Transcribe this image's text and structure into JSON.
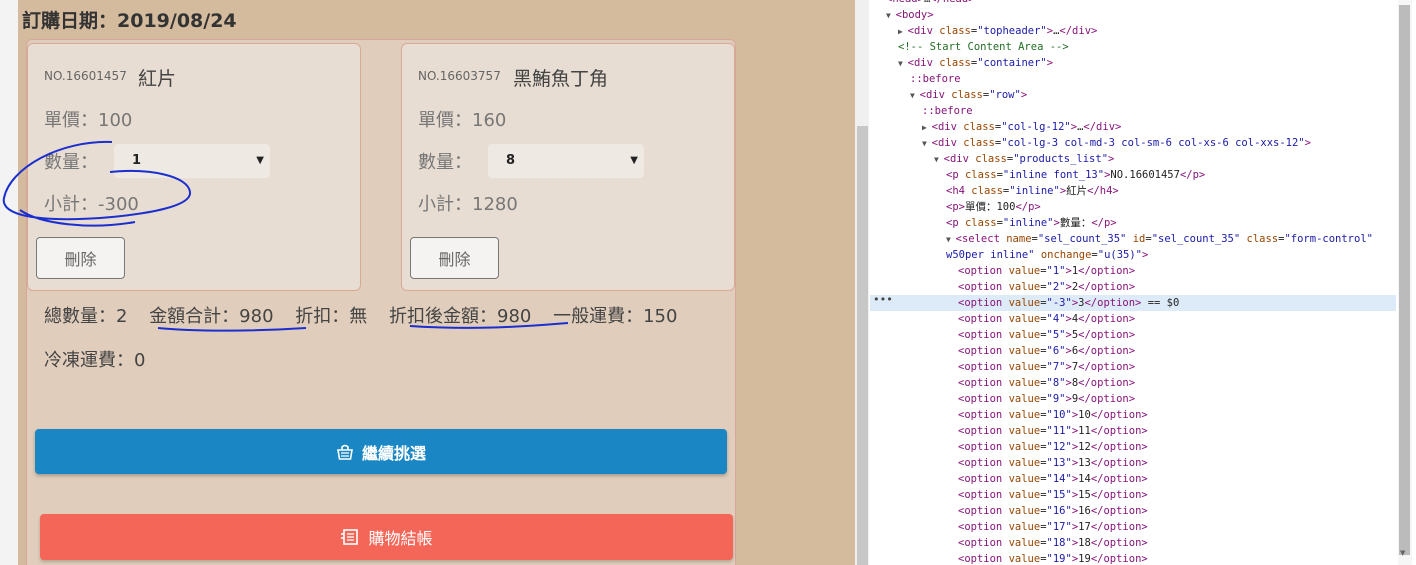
{
  "order": {
    "date_label": "訂購日期：2019/08/24"
  },
  "products": [
    {
      "no": "NO.16601457",
      "name": "紅片",
      "price": "單價：100",
      "qty_label": "數量：",
      "qty_value": "1",
      "subtotal": "小計：-300",
      "delete_label": "刪除"
    },
    {
      "no": "NO.16603757",
      "name": "黑鮪魚丁角",
      "price": "單價：160",
      "qty_label": "數量：",
      "qty_value": "8",
      "subtotal": "小計：1280",
      "delete_label": "刪除"
    }
  ],
  "summary": {
    "total_qty": "總數量：2",
    "total_amount": "金額合計：980",
    "discount": "折扣：無",
    "after_discount": "折扣後金額：980",
    "normal_shipping": "一般運費：150",
    "frozen_shipping": "冷凍運費：0"
  },
  "buttons": {
    "continue": "繼續挑選",
    "continue_icon": "basket-icon",
    "checkout": "購物結帳",
    "checkout_icon": "receipt-icon"
  },
  "colors": {
    "page_bg": "#d5bb9e",
    "continue_btn": "#1a86c4",
    "checkout_btn": "#f46658",
    "annotation": "#1b2fcf"
  },
  "devtools": {
    "lines": [
      {
        "indent": 0,
        "tri": "",
        "tag": "<head>",
        "attrs": [],
        "text": "…</head>",
        "close": ""
      },
      {
        "indent": 0,
        "tri": "▼",
        "tag": "<body>",
        "attrs": [],
        "text": "",
        "close": ""
      },
      {
        "indent": 1,
        "tri": "▶",
        "tag": "<div",
        "attrs": [
          [
            "class",
            "topheader"
          ]
        ],
        "text": ">…</div>",
        "close": ""
      },
      {
        "indent": 1,
        "tri": "",
        "comment": "<!-- Start Content Area -->"
      },
      {
        "indent": 1,
        "tri": "▼",
        "tag": "<div",
        "attrs": [
          [
            "class",
            "container"
          ]
        ],
        "text": ">",
        "close": ""
      },
      {
        "indent": 2,
        "tri": "",
        "pseudo": "::before"
      },
      {
        "indent": 2,
        "tri": "▼",
        "tag": "<div",
        "attrs": [
          [
            "class",
            "row"
          ]
        ],
        "text": ">",
        "close": ""
      },
      {
        "indent": 3,
        "tri": "",
        "pseudo": "::before"
      },
      {
        "indent": 3,
        "tri": "▶",
        "tag": "<div",
        "attrs": [
          [
            "class",
            "col-lg-12"
          ]
        ],
        "text": ">…</div>",
        "close": ""
      },
      {
        "indent": 3,
        "tri": "▼",
        "tag": "<div",
        "attrs": [
          [
            "class",
            "col-lg-3 col-md-3 col-sm-6 col-xs-6 col-xxs-12"
          ]
        ],
        "text": ">",
        "close": ""
      },
      {
        "indent": 4,
        "tri": "▼",
        "tag": "<div",
        "attrs": [
          [
            "class",
            "products_list"
          ]
        ],
        "text": ">",
        "close": ""
      },
      {
        "indent": 5,
        "tri": "",
        "tag": "<p",
        "attrs": [
          [
            "class",
            "inline font_13"
          ]
        ],
        "text": ">NO.16601457</p>",
        "close": ""
      },
      {
        "indent": 5,
        "tri": "",
        "tag": "<h4",
        "attrs": [
          [
            "class",
            "inline"
          ]
        ],
        "text": ">紅片</h4>",
        "close": ""
      },
      {
        "indent": 5,
        "tri": "",
        "tag": "<p>",
        "attrs": [],
        "text": "單價：100</p>",
        "close": ""
      },
      {
        "indent": 5,
        "tri": "",
        "tag": "<p",
        "attrs": [
          [
            "class",
            "inline"
          ]
        ],
        "text": ">數量：</p>",
        "close": ""
      },
      {
        "indent": 5,
        "tri": "▼",
        "tag": "<select",
        "attrs": [
          [
            "name",
            "sel_count_35"
          ],
          [
            "id",
            "sel_count_35"
          ],
          [
            "class",
            "form-control"
          ]
        ],
        "text": "",
        "close": ""
      },
      {
        "indent": 5,
        "tri": "",
        "cont": true,
        "attrs": [
          [
            "class_cont",
            "w50per inline"
          ],
          [
            "onchange",
            "u(35)"
          ]
        ],
        "text": ">"
      },
      {
        "indent": 6,
        "tri": "",
        "tag": "<option",
        "attrs": [
          [
            "value",
            "1"
          ]
        ],
        "text": ">1</option>"
      },
      {
        "indent": 6,
        "tri": "",
        "tag": "<option",
        "attrs": [
          [
            "value",
            "2"
          ]
        ],
        "text": ">2</option>"
      },
      {
        "indent": 6,
        "tri": "",
        "tag": "<option",
        "attrs": [
          [
            "value",
            "-3"
          ]
        ],
        "text": ">3</option>",
        "selected": true,
        "suffix": " == $0"
      },
      {
        "indent": 6,
        "tri": "",
        "tag": "<option",
        "attrs": [
          [
            "value",
            "4"
          ]
        ],
        "text": ">4</option>"
      },
      {
        "indent": 6,
        "tri": "",
        "tag": "<option",
        "attrs": [
          [
            "value",
            "5"
          ]
        ],
        "text": ">5</option>"
      },
      {
        "indent": 6,
        "tri": "",
        "tag": "<option",
        "attrs": [
          [
            "value",
            "6"
          ]
        ],
        "text": ">6</option>"
      },
      {
        "indent": 6,
        "tri": "",
        "tag": "<option",
        "attrs": [
          [
            "value",
            "7"
          ]
        ],
        "text": ">7</option>"
      },
      {
        "indent": 6,
        "tri": "",
        "tag": "<option",
        "attrs": [
          [
            "value",
            "8"
          ]
        ],
        "text": ">8</option>"
      },
      {
        "indent": 6,
        "tri": "",
        "tag": "<option",
        "attrs": [
          [
            "value",
            "9"
          ]
        ],
        "text": ">9</option>"
      },
      {
        "indent": 6,
        "tri": "",
        "tag": "<option",
        "attrs": [
          [
            "value",
            "10"
          ]
        ],
        "text": ">10</option>"
      },
      {
        "indent": 6,
        "tri": "",
        "tag": "<option",
        "attrs": [
          [
            "value",
            "11"
          ]
        ],
        "text": ">11</option>"
      },
      {
        "indent": 6,
        "tri": "",
        "tag": "<option",
        "attrs": [
          [
            "value",
            "12"
          ]
        ],
        "text": ">12</option>"
      },
      {
        "indent": 6,
        "tri": "",
        "tag": "<option",
        "attrs": [
          [
            "value",
            "13"
          ]
        ],
        "text": ">13</option>"
      },
      {
        "indent": 6,
        "tri": "",
        "tag": "<option",
        "attrs": [
          [
            "value",
            "14"
          ]
        ],
        "text": ">14</option>"
      },
      {
        "indent": 6,
        "tri": "",
        "tag": "<option",
        "attrs": [
          [
            "value",
            "15"
          ]
        ],
        "text": ">15</option>"
      },
      {
        "indent": 6,
        "tri": "",
        "tag": "<option",
        "attrs": [
          [
            "value",
            "16"
          ]
        ],
        "text": ">16</option>"
      },
      {
        "indent": 6,
        "tri": "",
        "tag": "<option",
        "attrs": [
          [
            "value",
            "17"
          ]
        ],
        "text": ">17</option>"
      },
      {
        "indent": 6,
        "tri": "",
        "tag": "<option",
        "attrs": [
          [
            "value",
            "18"
          ]
        ],
        "text": ">18</option>"
      },
      {
        "indent": 6,
        "tri": "",
        "tag": "<option",
        "attrs": [
          [
            "value",
            "19"
          ]
        ],
        "text": ">19</option>"
      }
    ],
    "dots": "•••"
  }
}
